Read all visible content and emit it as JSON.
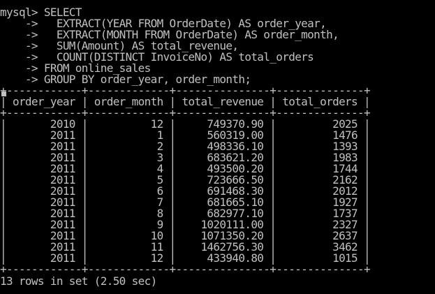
{
  "terminal": {
    "query_lines": [
      "mysql> SELECT",
      "    ->   EXTRACT(YEAR FROM OrderDate) AS order_year,",
      "    ->   EXTRACT(MONTH FROM OrderDate) AS order_month,",
      "    ->   SUM(Amount) AS total_revenue,",
      "    ->   COUNT(DISTINCT InvoiceNo) AS total_orders",
      "    -> FROM online_sales",
      "    -> GROUP BY order_year, order_month;"
    ],
    "table": {
      "border": "+------------+-------------+---------------+--------------+",
      "header": "| order_year | order_month | total_revenue | total_orders |",
      "rows": [
        "|       2010 |          12 |     749370.90 |         2025 |",
        "|       2011 |           1 |     560319.00 |         1476 |",
        "|       2011 |           2 |     498336.10 |         1393 |",
        "|       2011 |           3 |     683621.20 |         1983 |",
        "|       2011 |           4 |     493500.20 |         1744 |",
        "|       2011 |           5 |     723666.50 |         2162 |",
        "|       2011 |           6 |     691468.30 |         2012 |",
        "|       2011 |           7 |     681665.10 |         1927 |",
        "|       2011 |           8 |     682977.10 |         1737 |",
        "|       2011 |           9 |    1020111.00 |         2327 |",
        "|       2011 |          10 |    1071350.20 |         2637 |",
        "|       2011 |          11 |    1462756.30 |         3462 |",
        "|       2011 |          12 |     433940.80 |         1015 |"
      ]
    },
    "result_summary": "13 rows in set (2.50 sec)",
    "colors": {
      "background": "#000000",
      "text": "#c0c0c0"
    }
  }
}
